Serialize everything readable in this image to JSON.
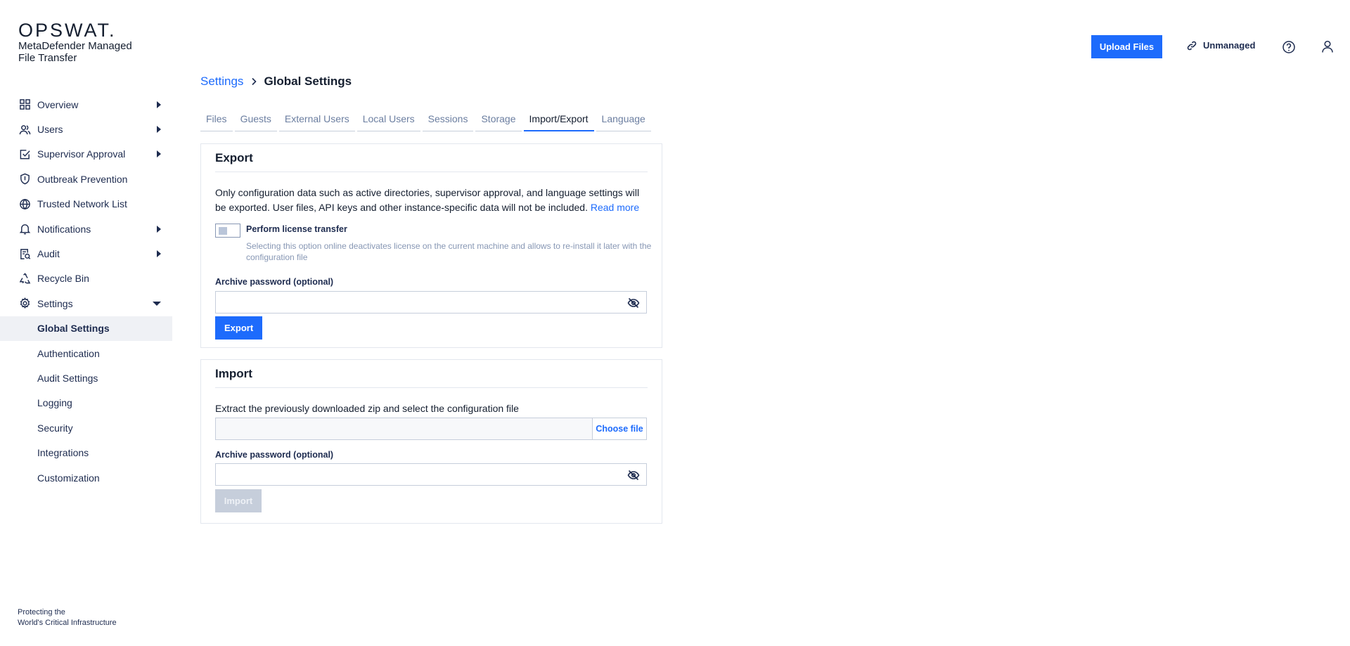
{
  "brand": {
    "logo": "OPSWAT.",
    "product_line1": "MetaDefender Managed",
    "product_line2": "File Transfer",
    "tagline_line1": "Protecting the",
    "tagline_line2": "World's Critical Infrastructure"
  },
  "header": {
    "upload_label": "Upload Files",
    "unmanaged_label": "Unmanaged"
  },
  "sidebar": {
    "items": [
      {
        "label": "Overview",
        "icon": "grid-icon",
        "expandable": true
      },
      {
        "label": "Users",
        "icon": "users-icon",
        "expandable": true
      },
      {
        "label": "Supervisor Approval",
        "icon": "checkbox-icon",
        "expandable": true
      },
      {
        "label": "Outbreak Prevention",
        "icon": "shield-icon",
        "expandable": false
      },
      {
        "label": "Trusted Network List",
        "icon": "globe-icon",
        "expandable": false
      },
      {
        "label": "Notifications",
        "icon": "bell-icon",
        "expandable": true
      },
      {
        "label": "Audit",
        "icon": "audit-icon",
        "expandable": true
      },
      {
        "label": "Recycle Bin",
        "icon": "recycle-icon",
        "expandable": false
      },
      {
        "label": "Settings",
        "icon": "gear-icon",
        "expanded": true
      }
    ],
    "settings_sub": [
      {
        "label": "Global Settings",
        "active": true
      },
      {
        "label": "Authentication"
      },
      {
        "label": "Audit Settings"
      },
      {
        "label": "Logging"
      },
      {
        "label": "Security"
      },
      {
        "label": "Integrations"
      },
      {
        "label": "Customization"
      }
    ]
  },
  "breadcrumb": {
    "parent": "Settings",
    "current": "Global Settings"
  },
  "tabs": [
    {
      "label": "Files"
    },
    {
      "label": "Guests"
    },
    {
      "label": "External Users"
    },
    {
      "label": "Local Users"
    },
    {
      "label": "Sessions"
    },
    {
      "label": "Storage"
    },
    {
      "label": "Import/Export",
      "active": true
    },
    {
      "label": "Language"
    }
  ],
  "export": {
    "title": "Export",
    "description": "Only configuration data such as active directories, supervisor approval, and language settings will be exported. User files, API keys and other instance-specific data will not be included.",
    "read_more": "Read more",
    "license_toggle_label": "Perform license transfer",
    "license_toggle_on": false,
    "license_help": "Selecting this option online deactivates license on the current machine and allows to re-install it later with the configuration file",
    "password_label": "Archive password (optional)",
    "password_value": "",
    "button_label": "Export"
  },
  "import": {
    "title": "Import",
    "description": "Extract the previously downloaded zip and select the configuration file",
    "choose_file_label": "Choose file",
    "password_label": "Archive password (optional)",
    "password_value": "",
    "button_label": "Import",
    "button_disabled": true
  },
  "colors": {
    "accent": "#1d6bfc",
    "text": "#141e2f",
    "muted": "#8797b4",
    "border": "#c6cedb",
    "disabled": "#c6cedb",
    "active_bg": "#eff1f5"
  }
}
